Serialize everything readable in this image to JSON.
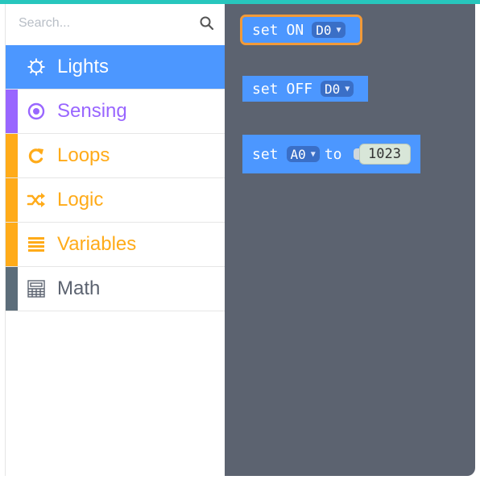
{
  "search": {
    "placeholder": "Search..."
  },
  "colors": {
    "accent_bar": "#27c6bd",
    "selected_category_bg": "#4c97ff",
    "workspace_bg": "#5c6370",
    "block_blue": "#4c97ff",
    "selection_outline": "#f29a38"
  },
  "categories": [
    {
      "label": "Lights",
      "icon": "gear-icon",
      "color": "#4c97ff",
      "selected": true
    },
    {
      "label": "Sensing",
      "icon": "target-icon",
      "color": "#9966ff",
      "selected": false
    },
    {
      "label": "Loops",
      "icon": "loop-arrow-icon",
      "color": "#ffab19",
      "selected": false
    },
    {
      "label": "Logic",
      "icon": "shuffle-icon",
      "color": "#ffab19",
      "selected": false
    },
    {
      "label": "Variables",
      "icon": "list-icon",
      "color": "#ffab19",
      "selected": false
    },
    {
      "label": "Math",
      "icon": "calculator-icon",
      "color": "#5c6d7a",
      "selected": false
    }
  ],
  "blocks": {
    "set_on": {
      "word1": "set",
      "word2": "ON",
      "pin": "D0"
    },
    "set_off": {
      "word1": "set",
      "word2": "OFF",
      "pin": "D0"
    },
    "set_analog": {
      "word1": "set",
      "pin": "A0",
      "word2": "to",
      "value": "1023"
    }
  }
}
